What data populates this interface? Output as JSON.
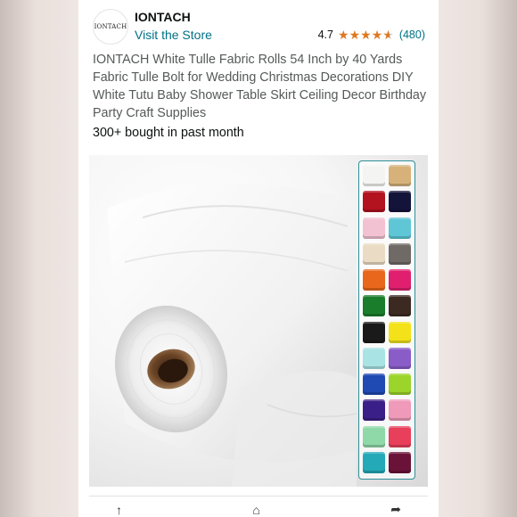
{
  "seller": {
    "logo_text": "IONTACH",
    "name": "IONTACH",
    "visit_label": "Visit the Store"
  },
  "rating": {
    "value": "4.7",
    "stars": 4.7,
    "count": "(480)",
    "star_color": "#de7921"
  },
  "product": {
    "title": "IONTACH White Tulle Fabric Rolls 54 Inch by 40 Yards Fabric Tulle Bolt for Wedding Christmas Decorations DIY White Tutu Baby Shower Table Skirt Ceiling Decor Birthday Party Craft Supplies",
    "bought": "300+ bought in past month"
  },
  "swatches": [
    "#f4f4f2",
    "#d6b27a",
    "#b3121f",
    "#14143a",
    "#f2c2d2",
    "#5fc6d6",
    "#eadcc4",
    "#6f6a66",
    "#e8671c",
    "#e01f6e",
    "#1a7d2c",
    "#3c2a22",
    "#1a1a1a",
    "#f3e21a",
    "#a9e3e3",
    "#8a5cc8",
    "#1f49b3",
    "#9bd42a",
    "#3b1f88",
    "#ef9ab9",
    "#8fd8a8",
    "#e83f5a",
    "#23a9b8",
    "#6b1238"
  ],
  "colors": {
    "link": "#007185",
    "text": "#0f1111",
    "muted": "#565959",
    "swatch_border": "#2f8f98"
  },
  "icons": {
    "upload": "upload-icon",
    "share": "share-icon"
  }
}
